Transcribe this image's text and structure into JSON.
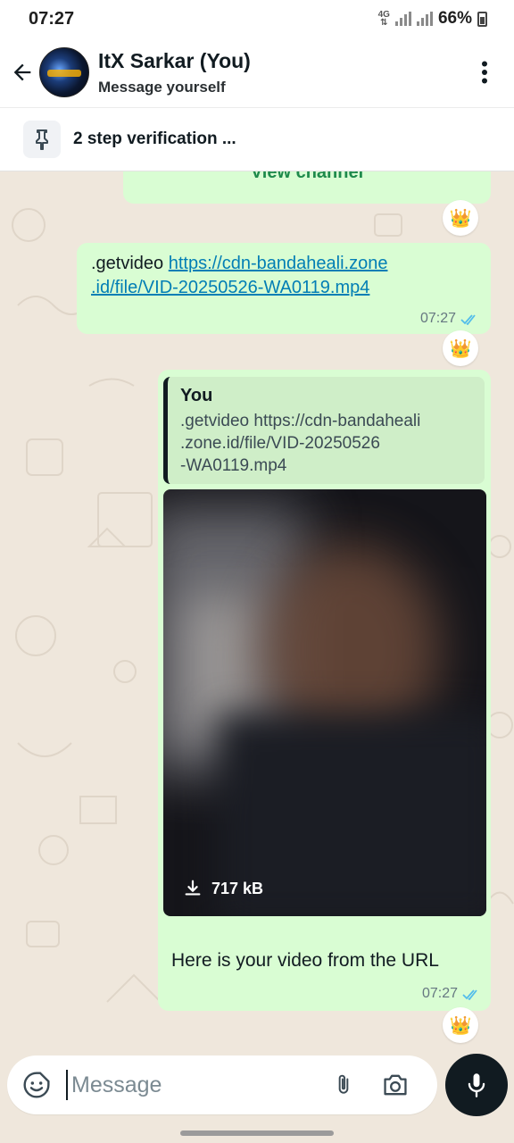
{
  "status_bar": {
    "time": "07:27",
    "network": "4G",
    "battery": "66%"
  },
  "header": {
    "name": "ItX Sarkar (You)",
    "subtitle": "Message yourself"
  },
  "pinned": {
    "text": "2 step verification ..."
  },
  "messages": [
    {
      "view_channel": "View channel",
      "reaction": "👑"
    },
    {
      "prefix": ".getvideo",
      "link": "https://cdn-bandaheali.zone.id/file/VID-20250526-WA0119.mp4",
      "link_line1": "https://cdn-bandaheali.zone",
      "link_line2": ".id/file/VID-20250526-WA0119.mp4",
      "time": "07:27",
      "reaction": "👑"
    },
    {
      "quote_author": "You",
      "quote_line1": ".getvideo https://cdn-bandaheali",
      "quote_line2": ".zone.id/file/VID-20250526",
      "quote_line3": "-WA0119.mp4",
      "video_size": "717 kB",
      "caption": "Here is your video from the URL",
      "time": "07:27",
      "reaction": "👑"
    }
  ],
  "composer": {
    "placeholder": "Message"
  },
  "colors": {
    "bubble": "#d9fdd3",
    "tick": "#53bdeb",
    "link": "#027eb5",
    "wallpaper": "#efe7dc"
  },
  "icons": [
    "arrow-left-icon",
    "more-vertical-icon",
    "pin-icon",
    "double-check-icon",
    "download-icon",
    "sticker-icon",
    "paperclip-icon",
    "camera-icon",
    "mic-icon"
  ]
}
